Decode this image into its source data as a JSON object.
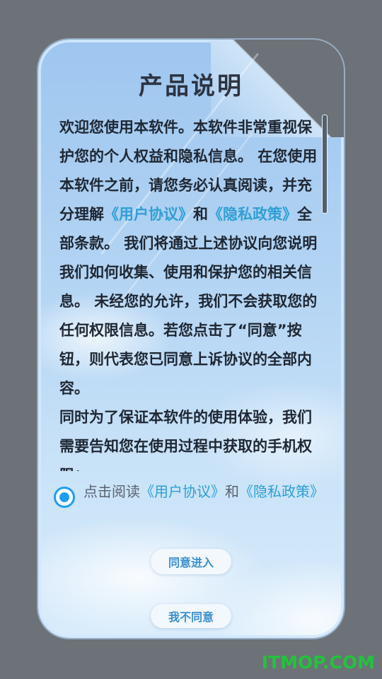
{
  "dialog": {
    "title": "产品说明",
    "body_1": "欢迎您使用本软件。本软件非常重视保护您的个人权益和隐私信息。 在您使用本软件之前，请您务必认真阅读，并充分理解",
    "link_user_agreement": "《用户协议》",
    "and": "和",
    "link_privacy_policy": "《隐私政策》",
    "body_2": "全部条款。 我们将通过上述协议向您说明我们如何收集、使用和保护您的相关信息。 未经您的允许，我们不会获取您的任何权限信息。若您点击了“同意”按钮，则代表您已同意上诉协议的全部内容。",
    "body_3": " 同时为了保证本软件的使用体验，我们需要告知您在使用过程中获取的手机权限："
  },
  "agree_row": {
    "prefix": "点击阅读",
    "link_user_agreement": "《用户协议》",
    "and": "和",
    "link_privacy_policy": "《隐私政策》",
    "checked": true
  },
  "buttons": {
    "agree_label": "同意进入",
    "decline_label": "我不同意"
  },
  "watermark": "ITMOP.COM",
  "colors": {
    "accent": "#1e9ef0",
    "link": "#2f9fd6",
    "watermark": "#22c33b"
  }
}
